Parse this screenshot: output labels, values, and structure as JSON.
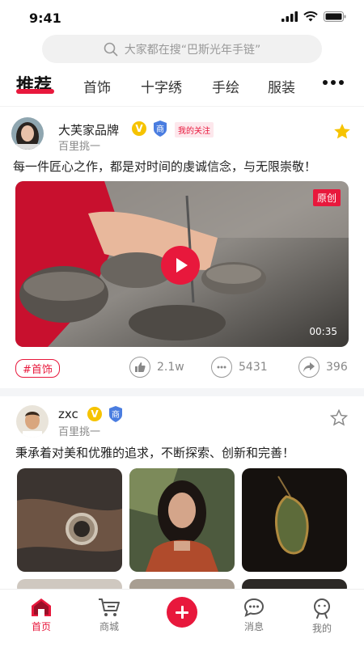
{
  "status_bar": {
    "time": "9:41"
  },
  "search": {
    "placeholder": "大家都在搜“巴斯光年手链”"
  },
  "tabs": [
    {
      "label": "推荐",
      "active": true
    },
    {
      "label": "首饰"
    },
    {
      "label": "十字绣"
    },
    {
      "label": "手绘"
    },
    {
      "label": "服装"
    }
  ],
  "posts": [
    {
      "author": "大芙家品牌",
      "subtitle": "百里挑一",
      "badge_v": "V",
      "badge_shang": "商",
      "follow_tag": "我的关注",
      "text": "每一件匠心之作，都是对时间的虔诚信念，与无限崇敬！",
      "video_badge": "原创",
      "duration": "00:35",
      "hashtag": "#首饰",
      "likes": "2.1w",
      "comments": "5431",
      "shares": "396",
      "starred": true
    },
    {
      "author": "zxc",
      "subtitle": "百里挑一",
      "badge_v": "V",
      "badge_shang": "商",
      "text": "秉承着对美和优雅的追求，不断探索、创新和完善！",
      "starred": false
    }
  ],
  "bottom_nav": [
    {
      "label": "首页",
      "active": true
    },
    {
      "label": "商城"
    },
    {
      "label": "消息"
    },
    {
      "label": "我的"
    }
  ],
  "colors": {
    "accent": "#e8183c",
    "vip": "#f6c300",
    "shang": "#4a7de0"
  }
}
